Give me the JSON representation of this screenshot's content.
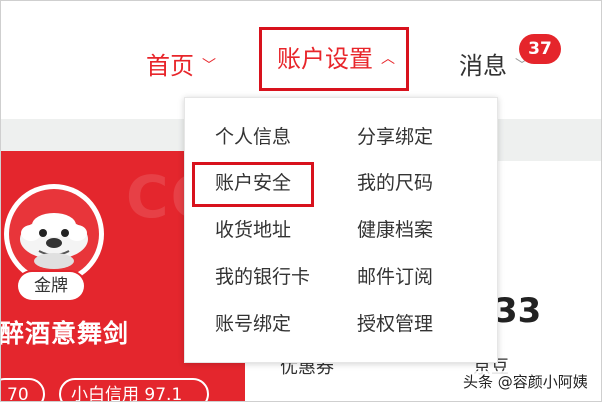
{
  "nav": {
    "home": "首页",
    "account_settings": "账户设置",
    "messages": "消息",
    "message_badge": "37"
  },
  "dropdown": {
    "column1": [
      "个人信息",
      "账户安全",
      "收货地址",
      "我的银行卡",
      "账号绑定"
    ],
    "column2": [
      "分享绑定",
      "我的尺码",
      "健康档案",
      "邮件订阅",
      "授权管理"
    ]
  },
  "profile": {
    "watermark": "COM",
    "level_badge": "金牌",
    "name": "醉酒意舞剑",
    "pill_left": "70",
    "pill_right": "小白信用 97.1"
  },
  "stats": {
    "number": "33",
    "coupon_label": "优惠券",
    "beans_label": "京豆"
  },
  "footer": {
    "text": "头条 @容颜小阿姨"
  },
  "colors": {
    "accent": "#e4262d",
    "highlight_border": "#d8121d"
  },
  "icons": [
    "chevron-down-icon",
    "chevron-up-icon",
    "avatar-face-icon"
  ]
}
